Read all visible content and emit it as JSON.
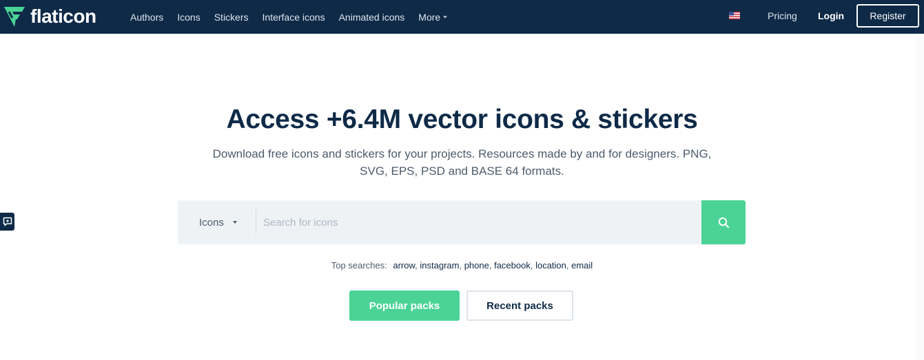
{
  "colors": {
    "navy": "#0e2a47",
    "green": "#4ad395"
  },
  "header": {
    "logo_icon": "flaticon-logo-icon",
    "logo_text": "flaticon",
    "nav": [
      {
        "label": "Authors"
      },
      {
        "label": "Icons"
      },
      {
        "label": "Stickers"
      },
      {
        "label": "Interface icons"
      },
      {
        "label": "Animated icons"
      },
      {
        "label": "More"
      }
    ],
    "language_icon": "us-flag-icon",
    "pricing_label": "Pricing",
    "login_label": "Login",
    "register_label": "Register"
  },
  "feedback_icon": "feedback-icon",
  "hero": {
    "title": "Access +6.4M vector icons & stickers",
    "subtitle": "Download free icons and stickers for your projects. Resources made by and for designers. PNG, SVG, EPS, PSD and BASE 64 formats."
  },
  "search": {
    "type_selected": "Icons",
    "placeholder": "Search for icons",
    "button_icon": "search-icon"
  },
  "top_searches": {
    "label": "Top searches:",
    "items": [
      "arrow",
      "instagram",
      "phone",
      "facebook",
      "location",
      "email"
    ]
  },
  "packs": {
    "popular_label": "Popular packs",
    "recent_label": "Recent packs"
  }
}
